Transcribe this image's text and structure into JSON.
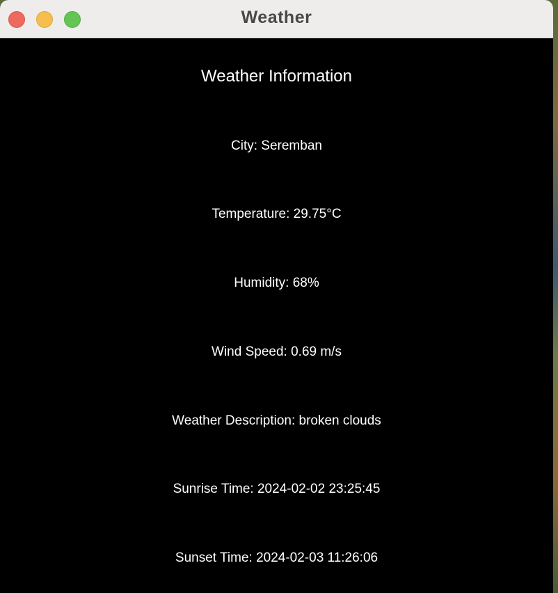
{
  "window": {
    "title": "Weather"
  },
  "main": {
    "heading": "Weather Information",
    "city": "City: Seremban",
    "temperature": "Temperature: 29.75°C",
    "humidity": "Humidity: 68%",
    "wind_speed": "Wind Speed: 0.69 m/s",
    "description": "Weather Description: broken clouds",
    "sunrise": "Sunrise Time: 2024-02-02 23:25:45",
    "sunset": "Sunset Time: 2024-02-03 11:26:06"
  },
  "colors": {
    "background": "#000000",
    "text": "#ffffff",
    "titlebar": "#efedeb",
    "close": "#ee6a5f",
    "minimize": "#f5be4f",
    "zoom": "#62c554"
  }
}
